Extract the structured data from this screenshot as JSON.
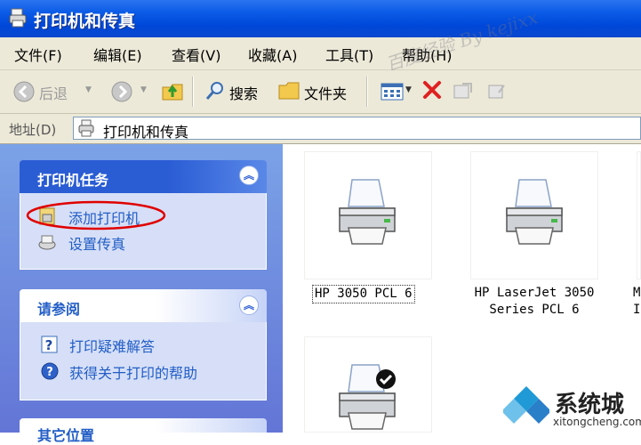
{
  "window": {
    "title": "打印机和传真"
  },
  "menu": {
    "items": [
      "文件(F)",
      "编辑(E)",
      "查看(V)",
      "收藏(A)",
      "工具(T)",
      "帮助(H)"
    ]
  },
  "watermark": "百度经验 By kejixx",
  "toolbar": {
    "back_label": "后退",
    "search_label": "搜索",
    "folders_label": "文件夹"
  },
  "address": {
    "label": "地址(D)",
    "value": "打印机和传真"
  },
  "tasks": {
    "printer_tasks": {
      "title": "打印机任务",
      "items": [
        "添加打印机",
        "设置传真"
      ]
    },
    "see_also": {
      "title": "请参阅",
      "items": [
        "打印疑难解答",
        "获得关于打印的帮助"
      ]
    },
    "other_places": {
      "title": "其它位置"
    }
  },
  "printers": [
    {
      "name_line1": "HP 3050 PCL 6",
      "name_line2": ""
    },
    {
      "name_line1": "HP LaserJet 3050",
      "name_line2": "Series PCL 6"
    },
    {
      "name_line1": "M",
      "name_line2": "I"
    }
  ],
  "logo": {
    "name": "系统城",
    "url": "xitongcheng.com"
  },
  "colors": {
    "titlebar": "#0a5ae6",
    "task_pane": "#6f8fe0",
    "panel_header": "#2a5cd4",
    "link": "#215dc6",
    "annotation_circle": "#e00000"
  }
}
